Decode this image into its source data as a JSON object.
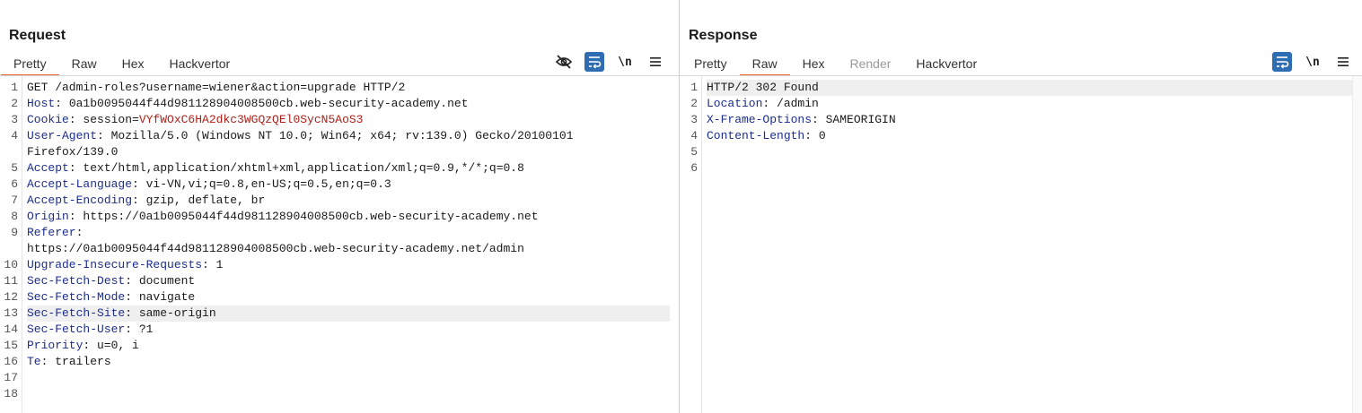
{
  "request": {
    "title": "Request",
    "tabs": [
      {
        "label": "Pretty",
        "active": true
      },
      {
        "label": "Raw"
      },
      {
        "label": "Hex"
      },
      {
        "label": "Hackvertor"
      }
    ],
    "toolbar": {
      "newline_label": "\\n",
      "icons": [
        "eye-slash-icon",
        "wrap-icon",
        "menu-icon"
      ]
    },
    "lines": [
      {
        "n": "1",
        "text": "GET /admin-roles?username=wiener&action=upgrade HTTP/2"
      },
      {
        "n": "2",
        "text": "Host: 0a1b0095044f44d981128904008500cb.web-security-academy.net"
      },
      {
        "n": "3",
        "text": "Cookie: session=VYfWOxC6HA2dkc3WGQzQEl0SycN5AoS3"
      },
      {
        "n": "4",
        "text": "User-Agent: Mozilla/5.0 (Windows NT 10.0; Win64; x64; rv:139.0) Gecko/20100101"
      },
      {
        "n": "",
        "text": "Firefox/139.0"
      },
      {
        "n": "5",
        "text": "Accept: text/html,application/xhtml+xml,application/xml;q=0.9,*/*;q=0.8"
      },
      {
        "n": "6",
        "text": "Accept-Language: vi-VN,vi;q=0.8,en-US;q=0.5,en;q=0.3"
      },
      {
        "n": "7",
        "text": "Accept-Encoding: gzip, deflate, br"
      },
      {
        "n": "8",
        "text": "Origin: https://0a1b0095044f44d981128904008500cb.web-security-academy.net"
      },
      {
        "n": "9",
        "text": "Referer:"
      },
      {
        "n": "",
        "text": "https://0a1b0095044f44d981128904008500cb.web-security-academy.net/admin"
      },
      {
        "n": "10",
        "text": "Upgrade-Insecure-Requests: 1"
      },
      {
        "n": "11",
        "text": "Sec-Fetch-Dest: document"
      },
      {
        "n": "12",
        "text": "Sec-Fetch-Mode: navigate"
      },
      {
        "n": "13",
        "text": "Sec-Fetch-Site: same-origin"
      },
      {
        "n": "14",
        "text": "Sec-Fetch-User: ?1"
      },
      {
        "n": "15",
        "text": "Priority: u=0, i"
      },
      {
        "n": "16",
        "text": "Te: trailers"
      },
      {
        "n": "17",
        "text": ""
      },
      {
        "n": "18",
        "text": ""
      }
    ]
  },
  "response": {
    "title": "Response",
    "tabs": [
      {
        "label": "Pretty"
      },
      {
        "label": "Raw",
        "active": true
      },
      {
        "label": "Hex"
      },
      {
        "label": "Render",
        "disabled": true
      },
      {
        "label": "Hackvertor"
      }
    ],
    "toolbar": {
      "newline_label": "\\n",
      "icons": [
        "wrap-icon",
        "menu-icon"
      ]
    },
    "lines": [
      {
        "n": "1",
        "text": "HTTP/2 302 Found"
      },
      {
        "n": "2",
        "text": "Location: /admin"
      },
      {
        "n": "3",
        "text": "X-Frame-Options: SAMEORIGIN"
      },
      {
        "n": "4",
        "text": "Content-Length: 0"
      },
      {
        "n": "5",
        "text": ""
      },
      {
        "n": "6",
        "text": ""
      }
    ]
  },
  "layout_toggle": {
    "options": [
      "side-by-side-icon",
      "stacked-icon",
      "single-icon"
    ],
    "active": "side-by-side-icon"
  },
  "colors": {
    "accent": "#e8612c",
    "button_blue": "#2f6db3",
    "header_key": "#1b2d8f",
    "cookie_value": "#b0201a"
  }
}
